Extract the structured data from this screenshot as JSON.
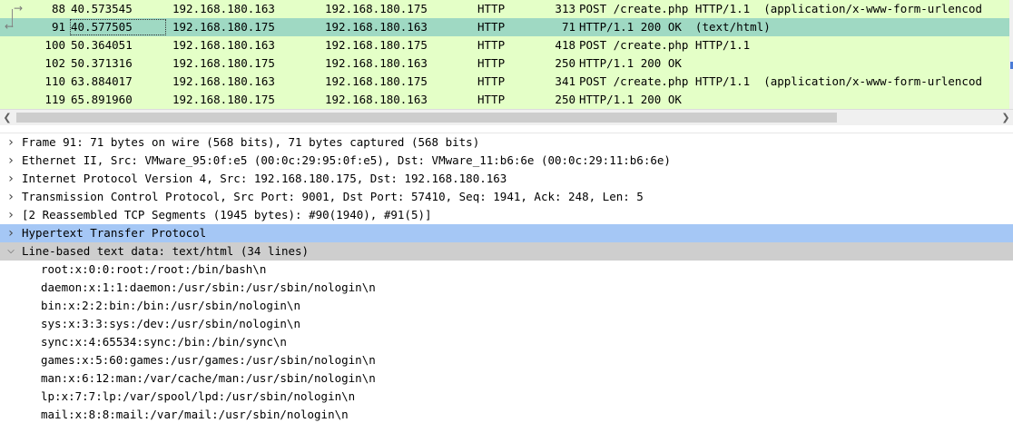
{
  "packet_list": {
    "rows": [
      {
        "no": "88",
        "time": "40.573545",
        "src": "192.168.180.163",
        "dst": "192.168.180.175",
        "proto": "HTTP",
        "len": "313",
        "info": "POST /create.php HTTP/1.1  (application/x-www-form-urlencod"
      },
      {
        "no": "91",
        "time": "40.577505",
        "src": "192.168.180.175",
        "dst": "192.168.180.163",
        "proto": "HTTP",
        "len": "71",
        "info": "HTTP/1.1 200 OK  (text/html)"
      },
      {
        "no": "100",
        "time": "50.364051",
        "src": "192.168.180.163",
        "dst": "192.168.180.175",
        "proto": "HTTP",
        "len": "418",
        "info": "POST /create.php HTTP/1.1"
      },
      {
        "no": "102",
        "time": "50.371316",
        "src": "192.168.180.175",
        "dst": "192.168.180.163",
        "proto": "HTTP",
        "len": "250",
        "info": "HTTP/1.1 200 OK"
      },
      {
        "no": "110",
        "time": "63.884017",
        "src": "192.168.180.163",
        "dst": "192.168.180.175",
        "proto": "HTTP",
        "len": "341",
        "info": "POST /create.php HTTP/1.1  (application/x-www-form-urlencod"
      },
      {
        "no": "119",
        "time": "65.891960",
        "src": "192.168.180.175",
        "dst": "192.168.180.163",
        "proto": "HTTP",
        "len": "250",
        "info": "HTTP/1.1 200 OK"
      }
    ],
    "selected_index": 1,
    "row_color": "#e4ffc7",
    "selected_color": "#9fd9c3"
  },
  "scrollbar": {
    "left_icon": "chevron-left-icon",
    "right_icon": "chevron-right-icon"
  },
  "details": {
    "tree": [
      {
        "label": "Frame 91: 71 bytes on wire (568 bits), 71 bytes captured (568 bits)",
        "expanded": false
      },
      {
        "label": "Ethernet II, Src: VMware_95:0f:e5 (00:0c:29:95:0f:e5), Dst: VMware_11:b6:6e (00:0c:29:11:b6:6e)",
        "expanded": false
      },
      {
        "label": "Internet Protocol Version 4, Src: 192.168.180.175, Dst: 192.168.180.163",
        "expanded": false
      },
      {
        "label": "Transmission Control Protocol, Src Port: 9001, Dst Port: 57410, Seq: 1941, Ack: 248, Len: 5",
        "expanded": false
      },
      {
        "label": "[2 Reassembled TCP Segments (1945 bytes): #90(1940), #91(5)]",
        "expanded": false
      },
      {
        "label": "Hypertext Transfer Protocol",
        "expanded": false,
        "highlight": true
      },
      {
        "label": "Line-based text data: text/html (34 lines)",
        "expanded": true
      }
    ],
    "text_lines": [
      "root:x:0:0:root:/root:/bin/bash\\n",
      "daemon:x:1:1:daemon:/usr/sbin:/usr/sbin/nologin\\n",
      "bin:x:2:2:bin:/bin:/usr/sbin/nologin\\n",
      "sys:x:3:3:sys:/dev:/usr/sbin/nologin\\n",
      "sync:x:4:65534:sync:/bin:/bin/sync\\n",
      "games:x:5:60:games:/usr/games:/usr/sbin/nologin\\n",
      "man:x:6:12:man:/var/cache/man:/usr/sbin/nologin\\n",
      "lp:x:7:7:lp:/var/spool/lpd:/usr/sbin/nologin\\n",
      "mail:x:8:8:mail:/var/mail:/usr/sbin/nologin\\n"
    ],
    "highlight_color": "#a5c7f5"
  }
}
